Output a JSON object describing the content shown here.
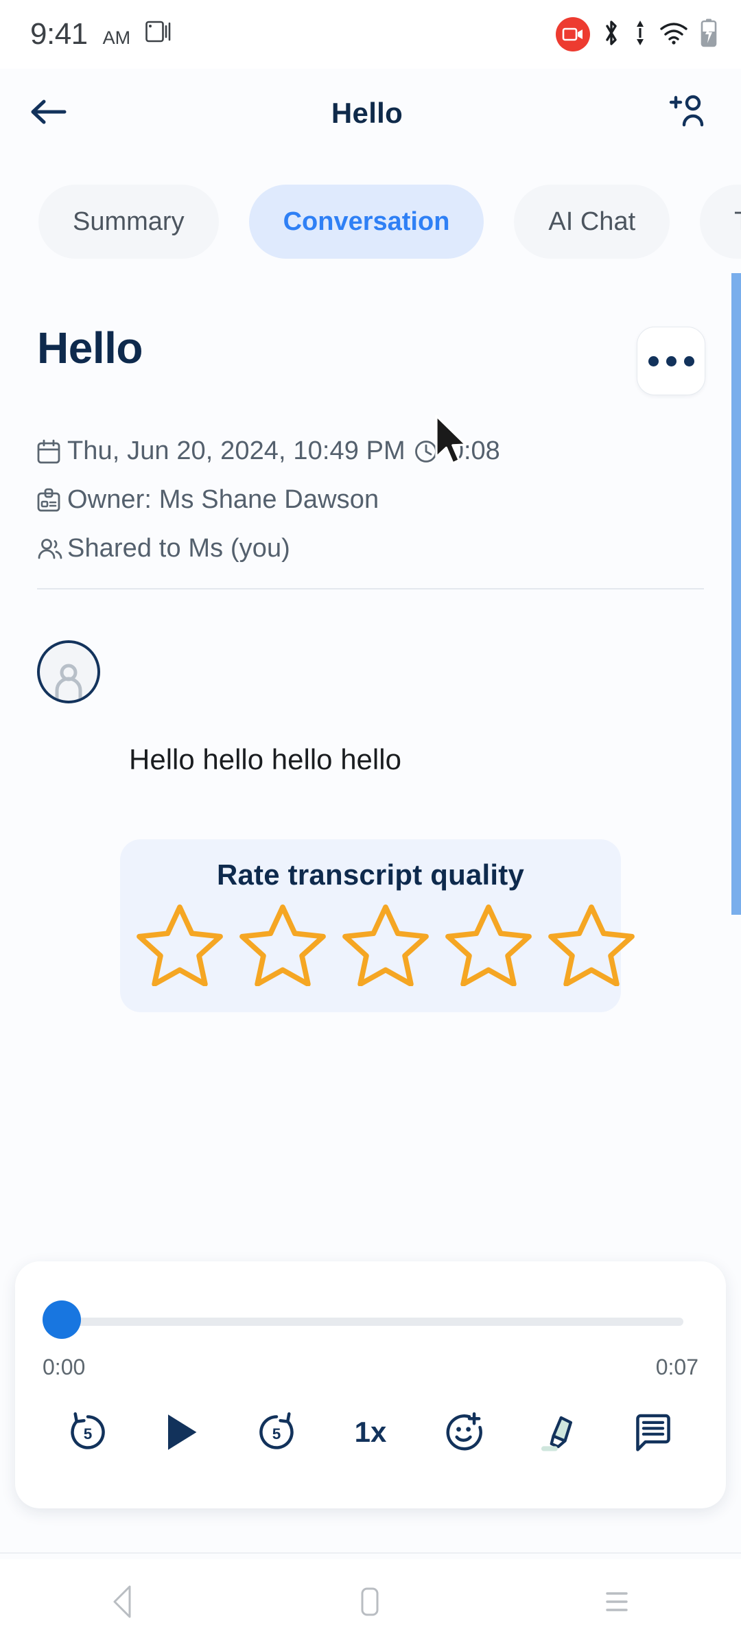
{
  "status_bar": {
    "time": "9:41",
    "ampm": "AM",
    "icons": [
      "screen-cast-icon",
      "screen-record-badge",
      "bluetooth-icon",
      "data-transfer-icon",
      "wifi-icon",
      "battery-charging-icon"
    ]
  },
  "app_bar": {
    "back_icon": "arrow-left-icon",
    "title": "Hello",
    "add_person_icon": "add-person-icon"
  },
  "tabs": [
    {
      "label": "Summary",
      "active": false
    },
    {
      "label": "Conversation",
      "active": true
    },
    {
      "label": "AI Chat",
      "active": false
    },
    {
      "label": "T",
      "active": false
    }
  ],
  "document": {
    "title": "Hello",
    "more_icon": "more-horizontal-icon",
    "meta": {
      "date": "Thu, Jun 20, 2024, 10:49 PM",
      "duration": "0:08",
      "owner": "Owner: Ms Shane Dawson",
      "shared": "Shared to Ms (you)",
      "calendar_icon": "calendar-icon",
      "clock_icon": "clock-icon",
      "badge_icon": "id-badge-icon",
      "people_icon": "people-icon"
    }
  },
  "message": {
    "avatar_icon": "person-avatar-icon",
    "text": "Hello hello hello hello"
  },
  "rating": {
    "title": "Rate transcript quality",
    "stars_total": 5,
    "stars_filled": 0,
    "star_color": "#f5a623",
    "card_bg": "#eef3fd"
  },
  "player": {
    "position": "0:00",
    "duration": "0:07",
    "progress_percent": 0,
    "controls": [
      {
        "name": "rewind-5-icon",
        "label": ""
      },
      {
        "name": "play-icon",
        "label": ""
      },
      {
        "name": "forward-5-icon",
        "label": ""
      },
      {
        "name": "playback-speed",
        "label": "1x"
      },
      {
        "name": "add-reaction-icon",
        "label": ""
      },
      {
        "name": "highlighter-icon",
        "label": ""
      },
      {
        "name": "transcript-icon",
        "label": ""
      }
    ]
  },
  "nav_bar": {
    "back_icon": "nav-back-icon",
    "home_icon": "nav-home-icon",
    "recents_icon": "nav-recents-icon"
  },
  "colors": {
    "accent_blue": "#2f80f5",
    "navy": "#0e2a4d",
    "star_orange": "#f5a623",
    "scrollbar_blue": "#79aeec",
    "record_red": "#ed3b30",
    "highlighter_mint": "#cfe6dd"
  }
}
